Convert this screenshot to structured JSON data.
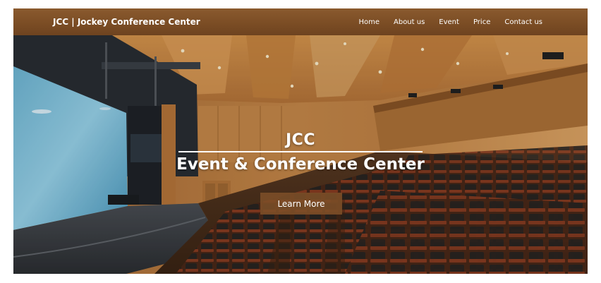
{
  "header": {
    "brand": "JCC | Jockey Conference Center",
    "nav": [
      {
        "label": "Home"
      },
      {
        "label": "About us"
      },
      {
        "label": "Event"
      },
      {
        "label": "Price"
      },
      {
        "label": "Contact us"
      }
    ]
  },
  "hero": {
    "title_line1": "JCC",
    "title_line2": "Event & Conference Center",
    "cta_label": "Learn More",
    "image": "auditorium-photo"
  },
  "colors": {
    "navbar": "#7a4c24",
    "cta_background": "#7d4e28",
    "text": "#ffffff"
  }
}
